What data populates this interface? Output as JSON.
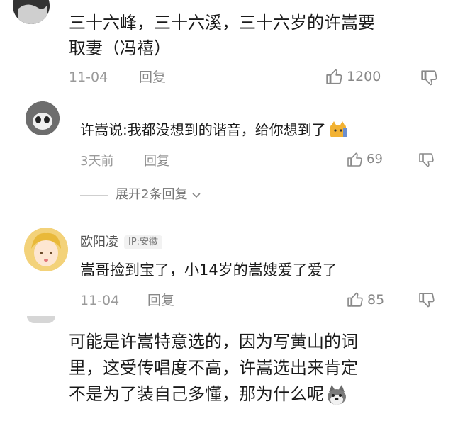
{
  "comment1": {
    "text_line1": "三十六峰，三十六溪，三十六岁的许嵩要",
    "text_line2": "取妻（冯禧）",
    "date": "11-04",
    "reply_label": "回复",
    "likes": "1200"
  },
  "reply1": {
    "text": "许嵩说:我都没想到的谐音，给你想到了",
    "date": "3天前",
    "reply_label": "回复",
    "likes": "69"
  },
  "expand": {
    "label": "展开2条回复"
  },
  "comment2": {
    "author": "欧阳凌",
    "location": "IP:安徽",
    "text": "嵩哥捡到宝了，小14岁的嵩嫂爱了爱了",
    "date": "11-04",
    "reply_label": "回复",
    "likes": "85"
  },
  "comment3": {
    "text_line1": "可能是许嵩特意选的，因为写黄山的词",
    "text_line2": "里，这受传唱度不高，许嵩选出来肯定",
    "text_line3": "不是为了装自己多懂，那为什么呢"
  },
  "colors": {
    "text": "#1a1a1a",
    "muted": "#9a9a9a",
    "badge_bg": "#f2f2f2"
  },
  "icons": [
    "thumbs-up-icon",
    "thumbs-down-icon",
    "chevron-down-icon",
    "cat-emoji-icon",
    "husky-emoji-icon"
  ]
}
